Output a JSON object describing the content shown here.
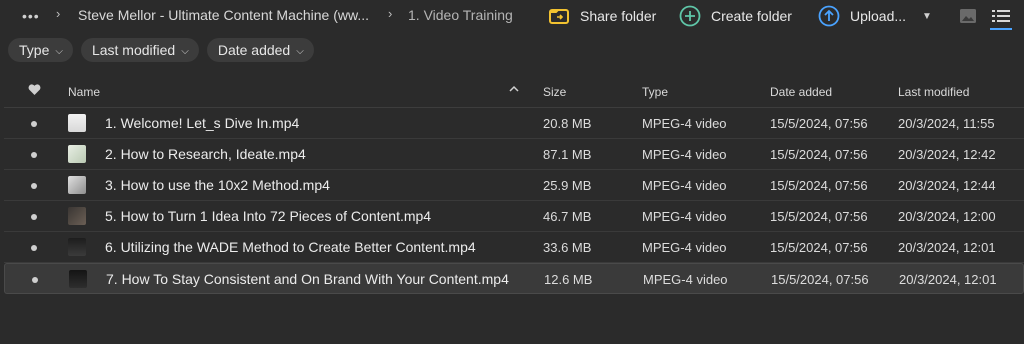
{
  "breadcrumb": {
    "more": "•••",
    "parent": "Steve Mellor - Ultimate Content Machine (ww...",
    "current": "1. Video Training"
  },
  "toolbar": {
    "share_label": "Share folder",
    "create_label": "Create folder",
    "upload_label": "Upload..."
  },
  "filters": [
    {
      "label": "Type"
    },
    {
      "label": "Last modified"
    },
    {
      "label": "Date added"
    }
  ],
  "columns": {
    "name": "Name",
    "size": "Size",
    "type": "Type",
    "added": "Date added",
    "modified": "Last modified"
  },
  "rows": [
    {
      "name": "1. Welcome! Let_s Dive In.mp4",
      "size": "20.8 MB",
      "type": "MPEG-4 video",
      "added": "15/5/2024, 07:56",
      "modified": "20/3/2024, 11:55"
    },
    {
      "name": "2. How to Research, Ideate.mp4",
      "size": "87.1 MB",
      "type": "MPEG-4 video",
      "added": "15/5/2024, 07:56",
      "modified": "20/3/2024, 12:42"
    },
    {
      "name": "3. How to use the 10x2 Method.mp4",
      "size": "25.9 MB",
      "type": "MPEG-4 video",
      "added": "15/5/2024, 07:56",
      "modified": "20/3/2024, 12:44"
    },
    {
      "name": "5. How to Turn 1 Idea Into 72 Pieces of Content.mp4",
      "size": "46.7 MB",
      "type": "MPEG-4 video",
      "added": "15/5/2024, 07:56",
      "modified": "20/3/2024, 12:00"
    },
    {
      "name": "6. Utilizing the WADE Method to Create Better Content.mp4",
      "size": "33.6 MB",
      "type": "MPEG-4 video",
      "added": "15/5/2024, 07:56",
      "modified": "20/3/2024, 12:01"
    },
    {
      "name": "7. How To Stay Consistent and On Brand With Your Content.mp4",
      "size": "12.6 MB",
      "type": "MPEG-4 video",
      "added": "15/5/2024, 07:56",
      "modified": "20/3/2024, 12:01"
    }
  ],
  "colors": {
    "accent": "#4aa3ff",
    "share_icon": "#f2c230",
    "create_icon": "#5fc6a8",
    "upload_icon": "#4aa3ff"
  }
}
